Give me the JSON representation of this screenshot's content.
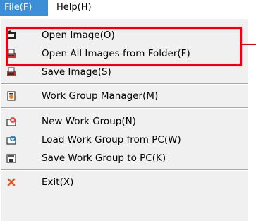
{
  "menubar": {
    "file_label": "File(F)",
    "help_label": "Help(H)"
  },
  "menu": {
    "items": [
      {
        "label": "Open Image(O)",
        "icon": "open-image-icon"
      },
      {
        "label": "Open All Images from Folder(F)",
        "icon": "open-folder-images-icon"
      },
      {
        "label": "Save Image(S)",
        "icon": "save-image-icon"
      },
      {
        "label": "Work Group Manager(M)",
        "icon": "work-group-manager-icon"
      },
      {
        "label": "New Work Group(N)",
        "icon": "new-work-group-icon"
      },
      {
        "label": "Load Work Group from PC(W)",
        "icon": "load-work-group-icon"
      },
      {
        "label": "Save Work Group to PC(K)",
        "icon": "save-work-group-icon"
      },
      {
        "label": "Exit(X)",
        "icon": "exit-icon"
      }
    ]
  },
  "colors": {
    "menubar_active_bg": "#3c8fd6",
    "highlight": "#e60012",
    "menu_bg": "#f0f0f0",
    "exit_icon": "#e8581c"
  }
}
